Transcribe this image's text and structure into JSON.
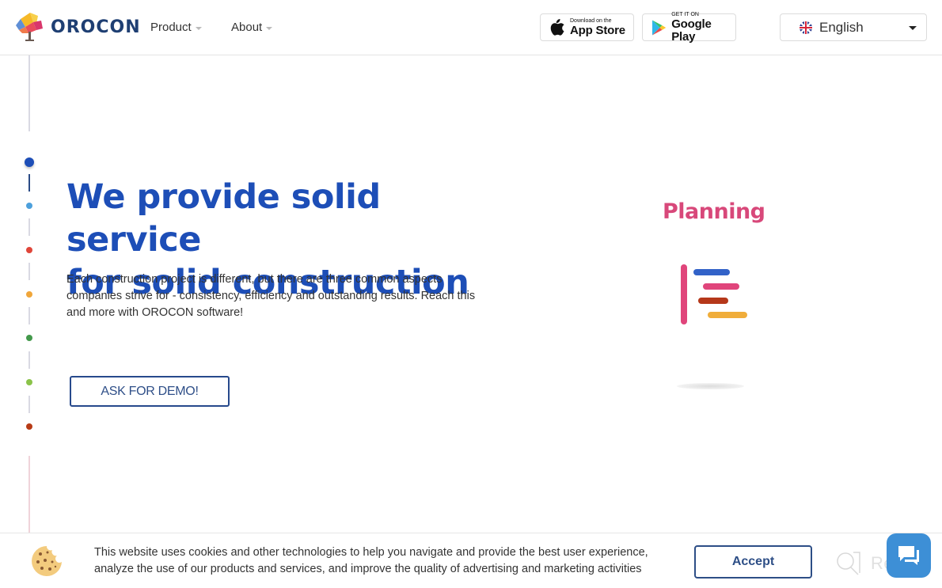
{
  "header": {
    "logo_text": "OROCON",
    "nav": [
      {
        "label": "Product"
      },
      {
        "label": "About"
      }
    ],
    "app_store": {
      "small": "Download on the",
      "big": "App Store"
    },
    "google_play": {
      "small": "GET IT ON",
      "big": "Google Play"
    },
    "language": {
      "selected": "English"
    }
  },
  "timeline": {
    "steps": [
      {
        "color": "#1d4eb7",
        "active": true
      },
      {
        "color": "#4da0dc",
        "active": false
      },
      {
        "color": "#e0463a",
        "active": false
      },
      {
        "color": "#f0a63a",
        "active": false
      },
      {
        "color": "#43994b",
        "active": false
      },
      {
        "color": "#8bc34a",
        "active": false
      },
      {
        "color": "#b73b16",
        "active": false
      }
    ]
  },
  "hero": {
    "title_line1": "We provide solid service",
    "title_line2": "for solid construction",
    "description": "Each construction project is different, but there are three common aspects companies strive for - consistency, efficiency and outstanding results. Reach this and more with OROCON software!",
    "cta_label": "ASK FOR DEMO!"
  },
  "illustration": {
    "title": "Planning",
    "colors": {
      "accent": "#d8487a",
      "bar1": "#3262c8",
      "bar2": "#e0457b",
      "bar3": "#b5381a",
      "bar4": "#f0ad3a"
    }
  },
  "cookie_bar": {
    "text_line1": "This website uses cookies and other technologies to help you navigate and provide the best user experience,",
    "text_line2": "analyze the use of our products and services, and improve the quality of advertising and marketing activities",
    "accept_label": "Accept"
  },
  "watermark": {
    "text": "Revain"
  }
}
